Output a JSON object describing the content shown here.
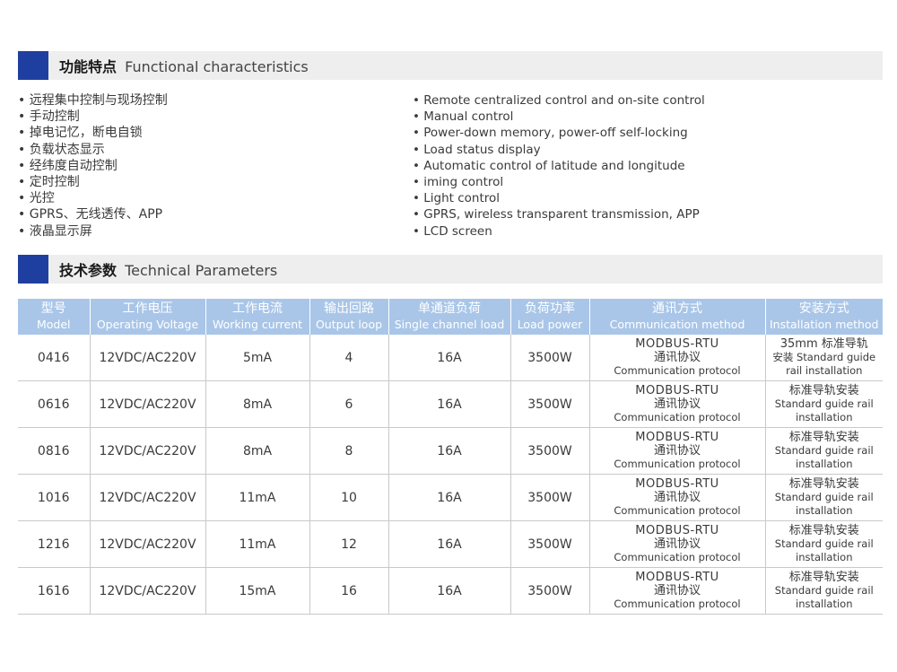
{
  "section1": {
    "title_cn": "功能特点",
    "title_en": "Functional characteristics"
  },
  "features_cn": [
    "远程集中控制与现场控制",
    "手动控制",
    "掉电记忆，断电自锁",
    "负载状态显示",
    "经纬度自动控制",
    "定时控制",
    "光控",
    "GPRS、无线透传、APP",
    "液晶显示屏"
  ],
  "features_en": [
    "Remote centralized control and on-site control",
    "Manual control",
    "Power-down memory, power-off self-locking",
    "Load status display",
    "Automatic control of latitude and longitude",
    "iming control",
    "Light control",
    "GPRS, wireless transparent transmission, APP",
    "LCD screen"
  ],
  "section2": {
    "title_cn": "技术参数",
    "title_en": "Technical Parameters"
  },
  "table": {
    "headers": [
      {
        "cn": "型号",
        "en": "Model"
      },
      {
        "cn": "工作电压",
        "en": "Operating Voltage"
      },
      {
        "cn": "工作电流",
        "en": "Working current"
      },
      {
        "cn": "输出回路",
        "en": "Output  loop"
      },
      {
        "cn": "单通道负荷",
        "en": "Single channel load"
      },
      {
        "cn": "负荷功率",
        "en": "Load power"
      },
      {
        "cn": "通讯方式",
        "en": "Communication method"
      },
      {
        "cn": "安装方式",
        "en": "Installation method"
      }
    ],
    "rows": [
      {
        "model": "0416",
        "voltage": "12VDC/AC220V",
        "current": "5mA",
        "loop": "4",
        "load": "16A",
        "power": "3500W",
        "comm": [
          "MODBUS-RTU",
          "通讯协议",
          "Communication protocol"
        ],
        "install": [
          "35mm 标准导轨",
          "安装 Standard guide",
          "rail installation"
        ]
      },
      {
        "model": "0616",
        "voltage": "12VDC/AC220V",
        "current": "8mA",
        "loop": "6",
        "load": "16A",
        "power": "3500W",
        "comm": [
          "MODBUS-RTU",
          "通讯协议",
          "Communication protocol"
        ],
        "install": [
          "标准导轨安装",
          "Standard guide rail",
          "installation"
        ]
      },
      {
        "model": "0816",
        "voltage": "12VDC/AC220V",
        "current": "8mA",
        "loop": "8",
        "load": "16A",
        "power": "3500W",
        "comm": [
          "MODBUS-RTU",
          "通讯协议",
          "Communication protocol"
        ],
        "install": [
          "标准导轨安装",
          "Standard guide rail",
          "installation"
        ]
      },
      {
        "model": "1016",
        "voltage": "12VDC/AC220V",
        "current": "11mA",
        "loop": "10",
        "load": "16A",
        "power": "3500W",
        "comm": [
          "MODBUS-RTU",
          "通讯协议",
          "Communication protocol"
        ],
        "install": [
          "标准导轨安装",
          "Standard guide rail",
          "installation"
        ]
      },
      {
        "model": "1216",
        "voltage": "12VDC/AC220V",
        "current": "11mA",
        "loop": "12",
        "load": "16A",
        "power": "3500W",
        "comm": [
          "MODBUS-RTU",
          "通讯协议",
          "Communication protocol"
        ],
        "install": [
          "标准导轨安装",
          "Standard guide rail",
          "installation"
        ]
      },
      {
        "model": "1616",
        "voltage": "12VDC/AC220V",
        "current": "15mA",
        "loop": "16",
        "load": "16A",
        "power": "3500W",
        "comm": [
          "MODBUS-RTU",
          "通讯协议",
          "Communication protocol"
        ],
        "install": [
          "标准导轨安装",
          "Standard guide rail",
          "installation"
        ]
      }
    ]
  }
}
